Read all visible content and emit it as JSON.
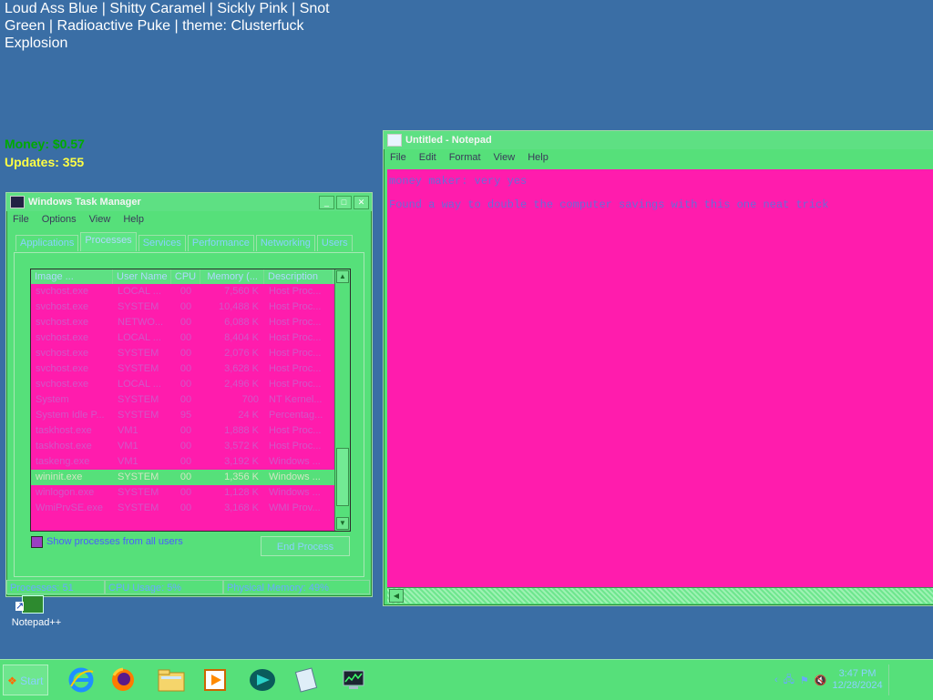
{
  "desktop": {
    "themes_text": "Loud Ass Blue | Shitty Caramel | Sickly Pink | Snot Green | Radioactive Puke | theme: Clusterfuck Explosion",
    "money": "Money: $0.57",
    "updates": "Updates: 355",
    "icon_label": "Notepad++"
  },
  "task_manager": {
    "title": "Windows Task Manager",
    "menu": [
      "File",
      "Options",
      "View",
      "Help"
    ],
    "tabs": [
      "Applications",
      "Processes",
      "Services",
      "Performance",
      "Networking",
      "Users"
    ],
    "active_tab": "Processes",
    "columns": [
      "Image ...",
      "User Name",
      "CPU",
      "Memory (...",
      "Description"
    ],
    "rows": [
      [
        "svchost.exe",
        "LOCAL ...",
        "00",
        "7,560 K",
        "Host Proc..."
      ],
      [
        "svchost.exe",
        "SYSTEM",
        "00",
        "10,488 K",
        "Host Proc..."
      ],
      [
        "svchost.exe",
        "NETWO...",
        "00",
        "6,088 K",
        "Host Proc..."
      ],
      [
        "svchost.exe",
        "LOCAL ...",
        "00",
        "8,404 K",
        "Host Proc..."
      ],
      [
        "svchost.exe",
        "SYSTEM",
        "00",
        "2,076 K",
        "Host Proc..."
      ],
      [
        "svchost.exe",
        "SYSTEM",
        "00",
        "3,628 K",
        "Host Proc..."
      ],
      [
        "svchost.exe",
        "LOCAL ...",
        "00",
        "2,496 K",
        "Host Proc..."
      ],
      [
        "System",
        "SYSTEM",
        "00",
        "700",
        "NT Kernel..."
      ],
      [
        "System Idle P...",
        "SYSTEM",
        "95",
        "24 K",
        "Percentag..."
      ],
      [
        "taskhost.exe",
        "VM1",
        "00",
        "1,888 K",
        "Host Proc..."
      ],
      [
        "taskhost.exe",
        "VM1",
        "00",
        "3,572 K",
        "Host Proc..."
      ],
      [
        "taskeng.exe",
        "VM1",
        "00",
        "3,192 K",
        "Windows ..."
      ],
      [
        "wininit.exe",
        "SYSTEM",
        "00",
        "1,356 K",
        "Windows ..."
      ],
      [
        "winlogon.exe",
        "SYSTEM",
        "00",
        "1,128 K",
        "Windows ..."
      ],
      [
        "WmiPrvSE.exe",
        "SYSTEM",
        "00",
        "3,168 K",
        "WMI Prov..."
      ]
    ],
    "selected_row": 12,
    "show_all_label": "Show processes from all users",
    "end_process_label": "End Process",
    "status": {
      "processes": "Processes: 51",
      "cpu": "CPU Usage: 5%",
      "memory": "Physical Memory: 49%"
    }
  },
  "notepad": {
    "title": "Untitled - Notepad",
    "menu": [
      "File",
      "Edit",
      "Format",
      "View",
      "Help"
    ],
    "lines": [
      "money maker: very yes",
      "Found a way to double the computer savings with this one neat trick"
    ]
  },
  "taskbar": {
    "start_label": "Start",
    "apps": [
      "internet-explorer-icon",
      "firefox-icon",
      "file-explorer-icon",
      "media-player-icon",
      "app-icon",
      "notepad-taskbar-icon",
      "task-manager-taskbar-icon"
    ],
    "clock_time": "3:47 PM",
    "clock_date": "12/28/2024"
  },
  "colors": {
    "desktop": "#3a6ea5",
    "window_green": "#56e07a",
    "pink": "#ff1cad"
  }
}
